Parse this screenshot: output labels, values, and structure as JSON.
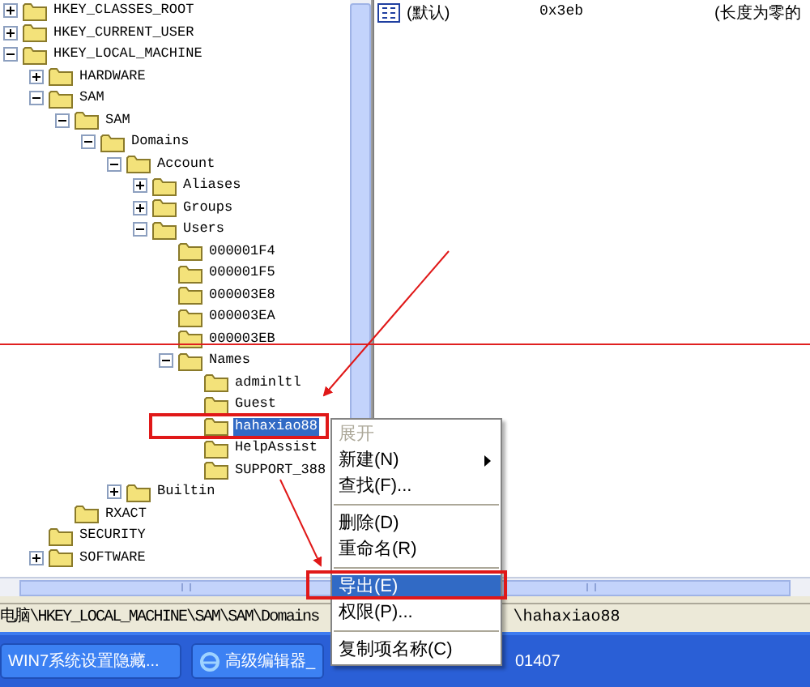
{
  "tree": [
    {
      "label": "HKEY_CLASSES_ROOT",
      "expanded": false
    },
    {
      "label": "HKEY_CURRENT_USER",
      "expanded": false
    },
    {
      "label": "HKEY_LOCAL_MACHINE",
      "expanded": true,
      "children": [
        {
          "label": "HARDWARE",
          "expanded": false
        },
        {
          "label": "SAM",
          "expanded": true,
          "children": [
            {
              "label": "SAM",
              "expanded": true,
              "children": [
                {
                  "label": "Domains",
                  "expanded": true,
                  "children": [
                    {
                      "label": "Account",
                      "expanded": true,
                      "children": [
                        {
                          "label": "Aliases",
                          "expanded": false
                        },
                        {
                          "label": "Groups",
                          "expanded": false
                        },
                        {
                          "label": "Users",
                          "expanded": true,
                          "children": [
                            {
                              "label": "000001F4",
                              "selected": false
                            },
                            {
                              "label": "000001F5",
                              "selected": false
                            },
                            {
                              "label": "000003E8",
                              "selected": false
                            },
                            {
                              "label": "000003EA",
                              "selected": false
                            },
                            {
                              "label": "000003EB",
                              "selected": false
                            },
                            {
                              "label": "Names",
                              "expanded": true,
                              "children": [
                                {
                                  "label": "adminltl",
                                  "selected": false
                                },
                                {
                                  "label": "Guest",
                                  "selected": false
                                },
                                {
                                  "label": "hahaxiao88",
                                  "selected": true
                                },
                                {
                                  "label": "HelpAssist",
                                  "selected": false
                                },
                                {
                                  "label": "SUPPORT_388",
                                  "selected": false
                                }
                              ]
                            }
                          ]
                        }
                      ]
                    },
                    {
                      "label": "Builtin",
                      "expanded": false
                    }
                  ]
                }
              ]
            },
            {
              "label": "RXACT",
              "selected": false
            }
          ]
        },
        {
          "label": "SECURITY",
          "selected": false
        },
        {
          "label": "SOFTWARE",
          "expanded": false
        }
      ]
    }
  ],
  "values": [
    {
      "name": "(默认)",
      "data": "0x3eb",
      "description": "(长度为零的"
    }
  ],
  "status_bar": {
    "path_start": "电脑\\HKEY_LOCAL_MACHINE\\SAM\\SAM\\Domains",
    "path_end": "\\hahaxiao88"
  },
  "taskbar": [
    {
      "label": "WIN7系统设置隐藏...",
      "icon": false
    },
    {
      "label": "高级编辑器_",
      "icon": true
    },
    {
      "label": "01407",
      "icon": false
    }
  ],
  "context_menu": [
    {
      "kind": "item",
      "label": "展开",
      "disabled": true,
      "selected": false,
      "submenu": false
    },
    {
      "kind": "item",
      "label": "新建(N)",
      "disabled": false,
      "selected": false,
      "submenu": true
    },
    {
      "kind": "item",
      "label": "查找(F)...",
      "disabled": false,
      "selected": false,
      "submenu": false
    },
    {
      "kind": "separator"
    },
    {
      "kind": "item",
      "label": "删除(D)",
      "disabled": false,
      "selected": false,
      "submenu": false
    },
    {
      "kind": "item",
      "label": "重命名(R)",
      "disabled": false,
      "selected": false,
      "submenu": false
    },
    {
      "kind": "separator"
    },
    {
      "kind": "item",
      "label": "导出(E)",
      "disabled": false,
      "selected": true,
      "submenu": false
    },
    {
      "kind": "item",
      "label": "权限(P)...",
      "disabled": false,
      "selected": false,
      "submenu": false
    },
    {
      "kind": "separator"
    },
    {
      "kind": "item",
      "label": "复制项名称(C)",
      "disabled": false,
      "selected": false,
      "submenu": false
    }
  ]
}
